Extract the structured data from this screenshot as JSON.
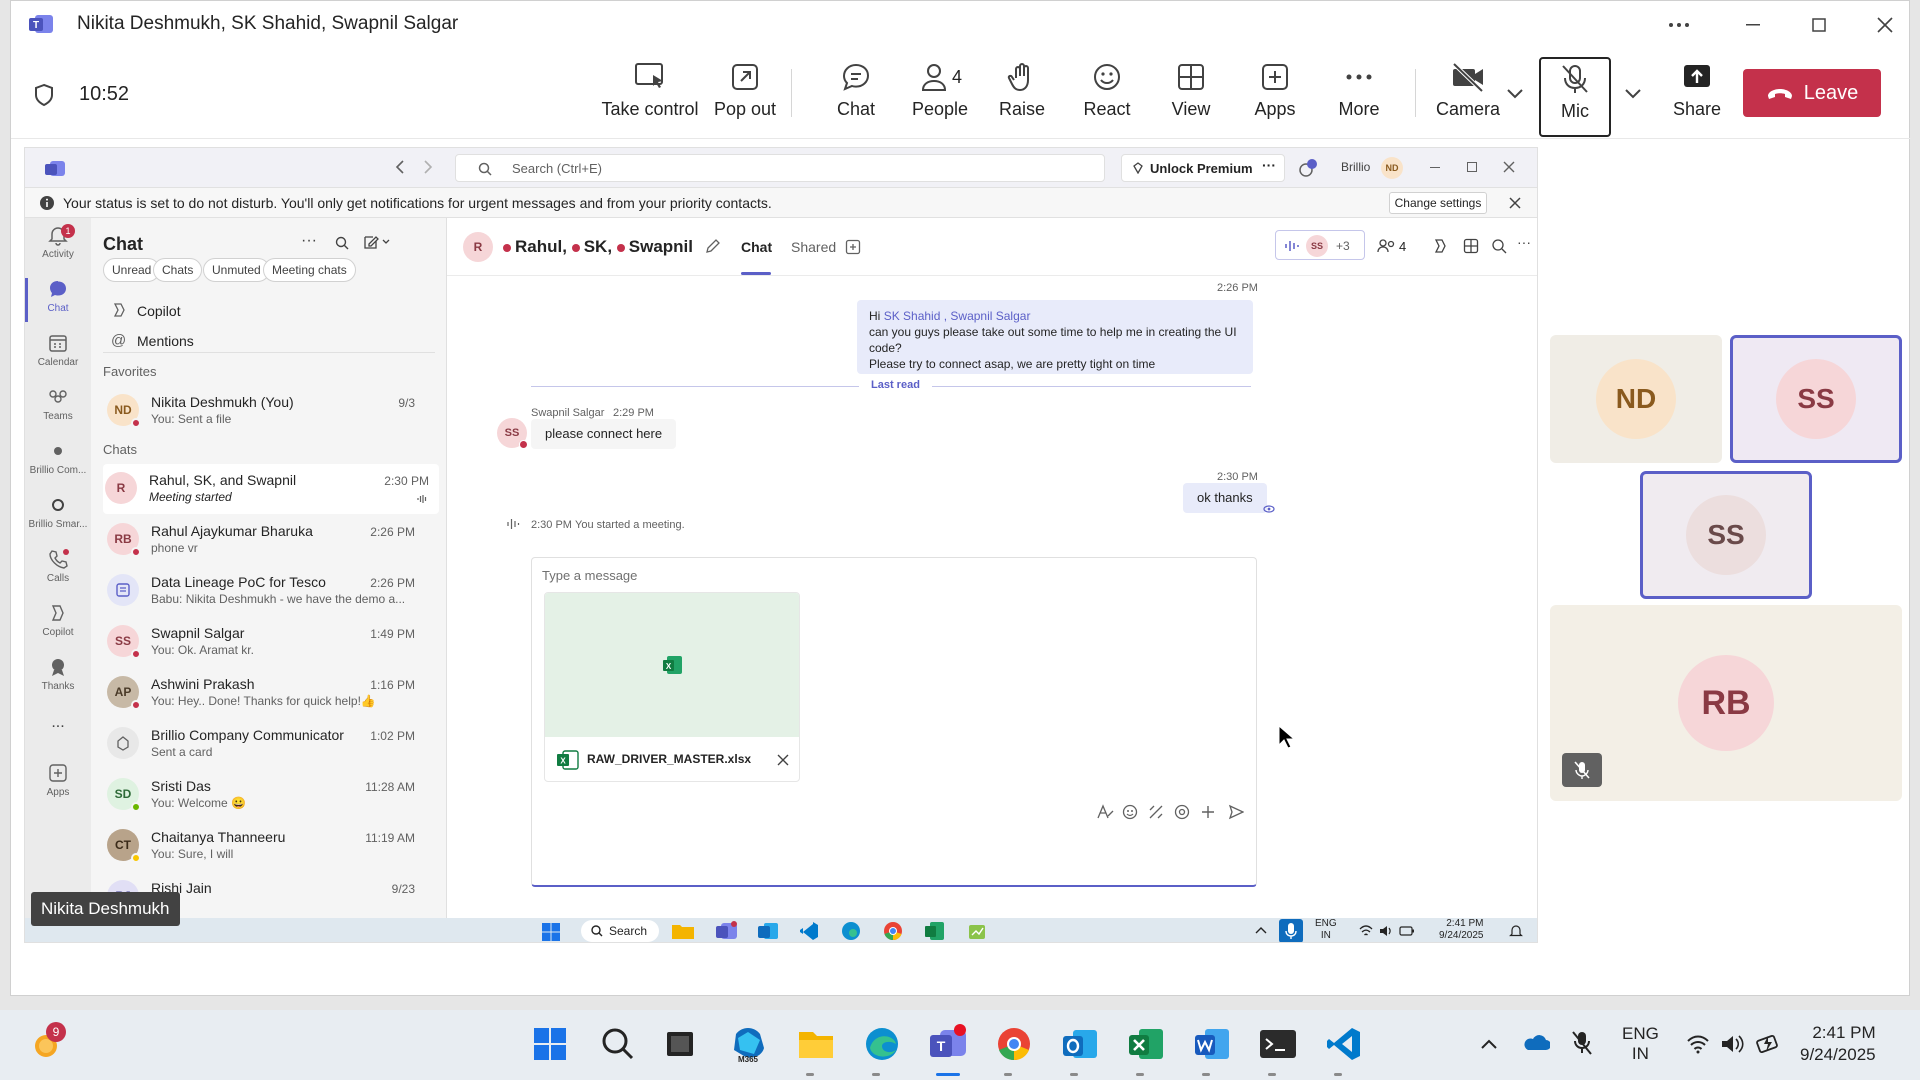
{
  "window": {
    "title": "Nikita Deshmukh, SK Shahid, Swapnil Salgar",
    "timer": "10:52"
  },
  "toolbar": {
    "take_control": "Take control",
    "pop_out": "Pop out",
    "chat": "Chat",
    "people": "People",
    "people_count": "4",
    "raise": "Raise",
    "react": "React",
    "view": "View",
    "apps": "Apps",
    "more": "More",
    "camera": "Camera",
    "mic": "Mic",
    "share": "Share",
    "leave": "Leave"
  },
  "inner": {
    "search_placeholder": "Search (Ctrl+E)",
    "unlock": "Unlock Premium",
    "org": "Brillio",
    "org_avatar": "ND",
    "banner_text": "Your status is set to do not disturb. You'll only get notifications for urgent messages and from your priority contacts.",
    "change_settings": "Change settings"
  },
  "rail": [
    {
      "label": "Activity",
      "badge": "1"
    },
    {
      "label": "Chat"
    },
    {
      "label": "Calendar"
    },
    {
      "label": "Teams"
    },
    {
      "label": "Brillio Com..."
    },
    {
      "label": "Brillio Smar..."
    },
    {
      "label": "Calls"
    },
    {
      "label": "Copilot"
    },
    {
      "label": "Thanks"
    },
    {
      "label": "..."
    },
    {
      "label": "Apps"
    }
  ],
  "chatlist": {
    "title": "Chat",
    "filters": [
      "Unread",
      "Chats",
      "Unmuted",
      "Meeting chats"
    ],
    "copilot": "Copilot",
    "mentions": "Mentions",
    "favorites_label": "Favorites",
    "chats_label": "Chats",
    "favorites": [
      {
        "initials": "ND",
        "name": "Nikita Deshmukh (You)",
        "preview": "You: Sent a file",
        "time": "9/3"
      }
    ],
    "chats": [
      {
        "initials": "R",
        "name": "Rahul, SK, and Swapnil",
        "preview": "Meeting started",
        "time": "2:30 PM"
      },
      {
        "initials": "RB",
        "name": "Rahul Ajaykumar Bharuka",
        "preview": "phone vr",
        "time": "2:26 PM"
      },
      {
        "initials": "",
        "name": "Data Lineage PoC for Tesco",
        "preview": "Babu: Nikita Deshmukh - we have the demo a...",
        "time": "2:26 PM"
      },
      {
        "initials": "SS",
        "name": "Swapnil Salgar",
        "preview": "You: Ok. Aramat kr.",
        "time": "1:49 PM"
      },
      {
        "initials": "AP",
        "name": "Ashwini Prakash",
        "preview": "You: Hey.. Done! Thanks for quick help!👍",
        "time": "1:16 PM"
      },
      {
        "initials": "",
        "name": "Brillio Company Communicator",
        "preview": "Sent a card",
        "time": "1:02 PM"
      },
      {
        "initials": "SD",
        "name": "Sristi Das",
        "preview": "You: Welcome 😀",
        "time": "11:28 AM"
      },
      {
        "initials": "CT",
        "name": "Chaitanya Thanneeru",
        "preview": "You: Sure, I will",
        "time": "11:19 AM"
      },
      {
        "initials": "RJ",
        "name": "Rishi Jain",
        "preview": "",
        "time": "9/23"
      }
    ]
  },
  "conversation": {
    "head_avatar": "R",
    "title_names": [
      "Rahul",
      "SK",
      "Swapnil"
    ],
    "tab_chat": "Chat",
    "tab_shared": "Shared",
    "call_avatar": "SS",
    "call_more": "+3",
    "people_count": "4",
    "msg1_time": "2:26 PM",
    "msg1_hi": "Hi",
    "msg1_mentions": "SK Shahid , Swapnil Salgar",
    "msg1_line2": "can you guys please take out some time to help me in creating the UI code?",
    "msg1_line3": "Please try to connect asap, we are pretty tight on time",
    "last_read": "Last read",
    "msg2_sender": "Swapnil Salgar",
    "msg2_time": "2:29 PM",
    "msg2_avatar": "SS",
    "msg2_text": "please connect here",
    "msg3_time": "2:30 PM",
    "msg3_text": "ok thanks",
    "event_time": "2:30 PM",
    "event_text": "You started a meeting.",
    "compose_placeholder": "Type a message",
    "attachment_name": "RAW_DRIVER_MASTER.xlsx"
  },
  "inner_taskbar": {
    "search": "Search",
    "lang1": "ENG",
    "lang2": "IN",
    "time": "2:41 PM",
    "date": "9/24/2025"
  },
  "presenter_label": "Nikita Deshmukh",
  "participants": [
    {
      "initials": "ND"
    },
    {
      "initials": "SS"
    },
    {
      "initials": "SS"
    },
    {
      "initials": "RB"
    }
  ],
  "taskbar": {
    "weather_badge": "9",
    "m365": "M365",
    "lang1": "ENG",
    "lang2": "IN",
    "time": "2:41 PM",
    "date": "9/24/2025"
  },
  "colors": {
    "brand": "#5b5fc7",
    "leave": "#c4314b",
    "dnd": "#c4314b",
    "online": "#6bb700"
  }
}
